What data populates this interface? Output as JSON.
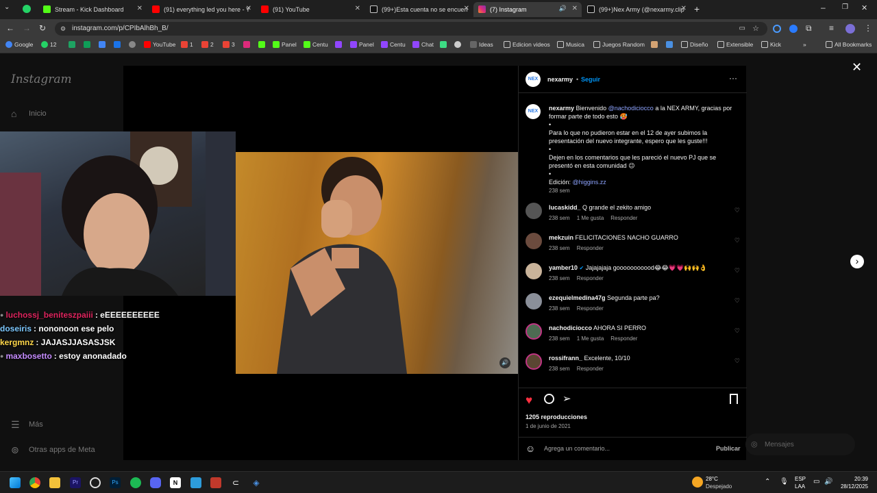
{
  "browser": {
    "tabs": [
      {
        "title": "Stream - Kick Dashboard",
        "color": "#53fc18"
      },
      {
        "title": "(91) everything led you here - Y",
        "color": "#ff0000"
      },
      {
        "title": "(91) YouTube",
        "color": "#ff0000"
      },
      {
        "title": "(99+)Esta cuenta no se encuen",
        "color": "#ffffff"
      },
      {
        "title": "(7) Instagram",
        "color": "#e1306c"
      },
      {
        "title": "(99+)Nex Army (@nexarmy.clip",
        "color": "#ffffff"
      }
    ],
    "url": "instagram.com/p/CPIbAlhBh_B/",
    "bookmarks": [
      "Google",
      "12",
      "YouTube",
      "1",
      "2",
      "3",
      "Panel",
      "Centu",
      "Panel",
      "Centu",
      "Chat",
      "Ideas",
      "Edicion videos",
      "Musica",
      "Juegos Random",
      "Diseño",
      "Extensible",
      "Kick"
    ],
    "all_bookmarks": "All Bookmarks"
  },
  "instagram": {
    "logo": "Instagram",
    "nav": {
      "home": "Inicio",
      "more": "Más",
      "meta": "Otras apps de Meta"
    },
    "post": {
      "author": "nexarmy",
      "follow": "Seguir",
      "caption_user": "nexarmy",
      "caption_1": "Bienvenido",
      "caption_mention": "@nachodiciocco",
      "caption_2": "a la NEX ARMY, gracias por formar parte de todo esto 🥵",
      "bullet": "•",
      "caption_3": "Para lo que no pudieron estar en el 12 de ayer subimos la presentación del nuevo integrante, espero que les guste!!!",
      "caption_4": "Dejen en los comentarios que les pareció el nuevo PJ que se presentó en esta comunidad 😉",
      "caption_edit": "Edición:",
      "caption_edit_mention": "@higgins.zz",
      "caption_time": "238 sem",
      "comments": [
        {
          "user": "lucaskidd_",
          "text": "Q grande el zekito amigo",
          "time": "238 sem",
          "likes": "1 Me gusta",
          "reply": "Responder"
        },
        {
          "user": "mekzuin",
          "text": "FELICITACIONES NACHO GUARRO",
          "time": "238 sem",
          "likes": "",
          "reply": "Responder"
        },
        {
          "user": "yamber10",
          "text": "Jajajajaja gooooooooood😂😂💗💗🙌🙌👌",
          "time": "238 sem",
          "likes": "",
          "reply": "Responder"
        },
        {
          "user": "ezequielmedina47g",
          "text": "Segunda parte pa?",
          "time": "238 sem",
          "likes": "",
          "reply": "Responder"
        },
        {
          "user": "nachodiciocco",
          "text": "AHORA SI PERRO",
          "time": "238 sem",
          "likes": "1 Me gusta",
          "reply": "Responder"
        },
        {
          "user": "rossifrann_",
          "text": "Excelente, 10/10",
          "time": "238 sem",
          "likes": "",
          "reply": "Responder"
        }
      ],
      "views": "1205 reproducciones",
      "date": "1 de junio de 2021",
      "comment_placeholder": "Agrega un comentario...",
      "publish": "Publicar"
    },
    "messages": "Mensajes"
  },
  "stream_chat": [
    {
      "user": "luchossj_beniteszpaiii",
      "msg": ": eEEEEEEEEEE",
      "color": "#e0245e"
    },
    {
      "user": "doseiris",
      "msg": ": nononoon ese pelo",
      "color": "#7cc8ff"
    },
    {
      "user": "kergmnz",
      "msg": ": JAJASJJASASJSK",
      "color": "#ffd84a"
    },
    {
      "user": "maxbosetto",
      "msg": ": estoy anonadado",
      "color": "#c58cff"
    }
  ],
  "taskbar": {
    "weather_temp": "28°C",
    "weather_desc": "Despejado",
    "lang": "ESP",
    "lang2": "LAA",
    "time": "20:39",
    "date": "28/12/2025"
  },
  "colors": {
    "accent": "#0095f6",
    "like": "#ff3040",
    "link": "#8ea4ff"
  }
}
